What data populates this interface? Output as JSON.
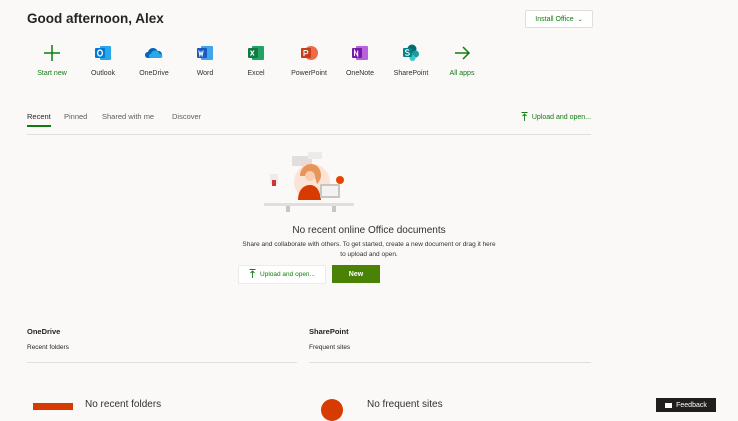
{
  "greeting": "Good afternoon, Alex",
  "install_office": "Install Office",
  "apps": [
    {
      "label": "Start new",
      "icon": "plus-icon",
      "color": "#107c10"
    },
    {
      "label": "Outlook",
      "icon": "outlook-icon",
      "color": "#0078d4"
    },
    {
      "label": "OneDrive",
      "icon": "onedrive-icon",
      "color": "#0364b8"
    },
    {
      "label": "Word",
      "icon": "word-icon",
      "color": "#185abd"
    },
    {
      "label": "Excel",
      "icon": "excel-icon",
      "color": "#107c41"
    },
    {
      "label": "PowerPoint",
      "icon": "powerpoint-icon",
      "color": "#c43e1c"
    },
    {
      "label": "OneNote",
      "icon": "onenote-icon",
      "color": "#7719aa"
    },
    {
      "label": "SharePoint",
      "icon": "sharepoint-icon",
      "color": "#038387"
    },
    {
      "label": "All apps",
      "icon": "arrow-right-icon",
      "color": "#107c10"
    }
  ],
  "tabs": [
    "Recent",
    "Pinned",
    "Shared with me",
    "Discover"
  ],
  "upload_open_link": "Upload and open...",
  "empty": {
    "title": "No recent online Office documents",
    "desc_line1": "Share and collaborate with others. To get started, create a new document or drag it here",
    "desc_line2": "to upload and open.",
    "upload_btn": "Upload and open...",
    "new_btn": "New"
  },
  "onedrive": {
    "title": "OneDrive",
    "sub": "Recent folders",
    "empty": "No recent folders"
  },
  "sharepoint": {
    "title": "SharePoint",
    "sub": "Frequent sites",
    "empty": "No frequent sites"
  },
  "feedback": "Feedback",
  "colors": {
    "accent": "#107c10",
    "new_button": "#498205"
  }
}
